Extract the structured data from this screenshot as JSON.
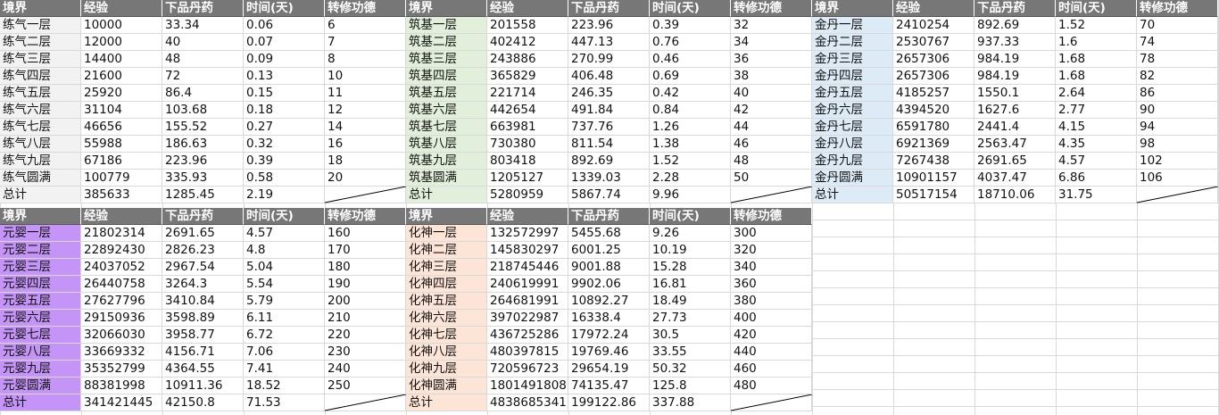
{
  "headers": [
    "境界",
    "经验",
    "下品丹药",
    "时间(天)",
    "转修功德"
  ],
  "colors": {
    "header_bg": "#777777",
    "lianqi": "#f2f2f2",
    "zhuji": "#e2efda",
    "jindan": "#ddebf7",
    "yuanying": "#c594f7",
    "huashen": "#fce4d6"
  },
  "blocks": [
    {
      "id": "lianqi",
      "rows": [
        [
          "练气一层",
          "10000",
          "33.34",
          "0.06",
          "6"
        ],
        [
          "练气二层",
          "12000",
          "40",
          "0.07",
          "7"
        ],
        [
          "练气三层",
          "14400",
          "48",
          "0.09",
          "8"
        ],
        [
          "练气四层",
          "21600",
          "72",
          "0.13",
          "10"
        ],
        [
          "练气五层",
          "25920",
          "86.4",
          "0.15",
          "11"
        ],
        [
          "练气六层",
          "31104",
          "103.68",
          "0.18",
          "12"
        ],
        [
          "练气七层",
          "46656",
          "155.52",
          "0.27",
          "14"
        ],
        [
          "练气八层",
          "55988",
          "186.63",
          "0.32",
          "16"
        ],
        [
          "练气九层",
          "67186",
          "223.96",
          "0.39",
          "18"
        ],
        [
          "练气圆满",
          "100779",
          "335.93",
          "0.58",
          "20"
        ]
      ],
      "total": [
        "总计",
        "385633",
        "1285.45",
        "2.19",
        ""
      ]
    },
    {
      "id": "zhuji",
      "rows": [
        [
          "筑基一层",
          "201558",
          "223.96",
          "0.39",
          "32"
        ],
        [
          "筑基二层",
          "402412",
          "447.13",
          "0.76",
          "34"
        ],
        [
          "筑基三层",
          "243886",
          "270.99",
          "0.46",
          "36"
        ],
        [
          "筑基四层",
          "365829",
          "406.48",
          "0.69",
          "38"
        ],
        [
          "筑基五层",
          "221714",
          "246.35",
          "0.42",
          "40"
        ],
        [
          "筑基六层",
          "442654",
          "491.84",
          "0.84",
          "42"
        ],
        [
          "筑基七层",
          "663981",
          "737.76",
          "1.26",
          "44"
        ],
        [
          "筑基八层",
          "730380",
          "811.54",
          "1.38",
          "46"
        ],
        [
          "筑基九层",
          "803418",
          "892.69",
          "1.52",
          "48"
        ],
        [
          "筑基圆满",
          "1205127",
          "1339.03",
          "2.28",
          "50"
        ]
      ],
      "total": [
        "总计",
        "5280959",
        "5867.74",
        "9.96",
        ""
      ]
    },
    {
      "id": "jindan",
      "rows": [
        [
          "金丹一层",
          "2410254",
          "892.69",
          "1.52",
          "70"
        ],
        [
          "金丹二层",
          "2530767",
          "937.33",
          "1.6",
          "74"
        ],
        [
          "金丹三层",
          "2657306",
          "984.19",
          "1.68",
          "78"
        ],
        [
          "金丹四层",
          "2657306",
          "984.19",
          "1.68",
          "82"
        ],
        [
          "金丹五层",
          "4185257",
          "1550.1",
          "2.64",
          "86"
        ],
        [
          "金丹六层",
          "4394520",
          "1627.6",
          "2.77",
          "90"
        ],
        [
          "金丹七层",
          "6591780",
          "2441.4",
          "4.15",
          "94"
        ],
        [
          "金丹八层",
          "6921369",
          "2563.47",
          "4.35",
          "98"
        ],
        [
          "金丹九层",
          "7267438",
          "2691.65",
          "4.57",
          "102"
        ],
        [
          "金丹圆满",
          "10901157",
          "4037.47",
          "6.86",
          "106"
        ]
      ],
      "total": [
        "总计",
        "50517154",
        "18710.06",
        "31.75",
        ""
      ]
    },
    {
      "id": "yuanying",
      "rows": [
        [
          "元婴一层",
          "21802314",
          "2691.65",
          "4.57",
          "160"
        ],
        [
          "元婴二层",
          "22892430",
          "2826.23",
          "4.8",
          "170"
        ],
        [
          "元婴三层",
          "24037052",
          "2967.54",
          "5.04",
          "180"
        ],
        [
          "元婴四层",
          "26440758",
          "3264.3",
          "5.54",
          "190"
        ],
        [
          "元婴五层",
          "27627796",
          "3410.84",
          "5.79",
          "200"
        ],
        [
          "元婴六层",
          "29150936",
          "3598.89",
          "6.11",
          "210"
        ],
        [
          "元婴七层",
          "32066030",
          "3958.77",
          "6.72",
          "220"
        ],
        [
          "元婴八层",
          "33669332",
          "4156.71",
          "7.06",
          "230"
        ],
        [
          "元婴九层",
          "35352799",
          "4364.55",
          "7.41",
          "240"
        ],
        [
          "元婴圆满",
          "88381998",
          "10911.36",
          "18.52",
          "250"
        ]
      ],
      "total": [
        "总计",
        "341421445",
        "42150.8",
        "71.53",
        ""
      ]
    },
    {
      "id": "huashen",
      "rows": [
        [
          "化神一层",
          "132572997",
          "5455.68",
          "9.26",
          "300"
        ],
        [
          "化神二层",
          "145830297",
          "6001.25",
          "10.19",
          "320"
        ],
        [
          "化神三层",
          "218745446",
          "9001.88",
          "15.28",
          "340"
        ],
        [
          "化神四层",
          "240619991",
          "9902.06",
          "16.81",
          "360"
        ],
        [
          "化神五层",
          "264681991",
          "10892.27",
          "18.49",
          "380"
        ],
        [
          "化神六层",
          "397022987",
          "16338.4",
          "27.73",
          "400"
        ],
        [
          "化神七层",
          "436725286",
          "17972.24",
          "30.5",
          "420"
        ],
        [
          "化神八层",
          "480397815",
          "19769.46",
          "33.55",
          "440"
        ],
        [
          "化神九层",
          "720596723",
          "29654.19",
          "50.32",
          "460"
        ],
        [
          "化神圆满",
          "1801491808",
          "74135.47",
          "125.8",
          "480"
        ]
      ],
      "total": [
        "总计",
        "4838685341",
        "199122.86",
        "337.88",
        ""
      ]
    }
  ]
}
